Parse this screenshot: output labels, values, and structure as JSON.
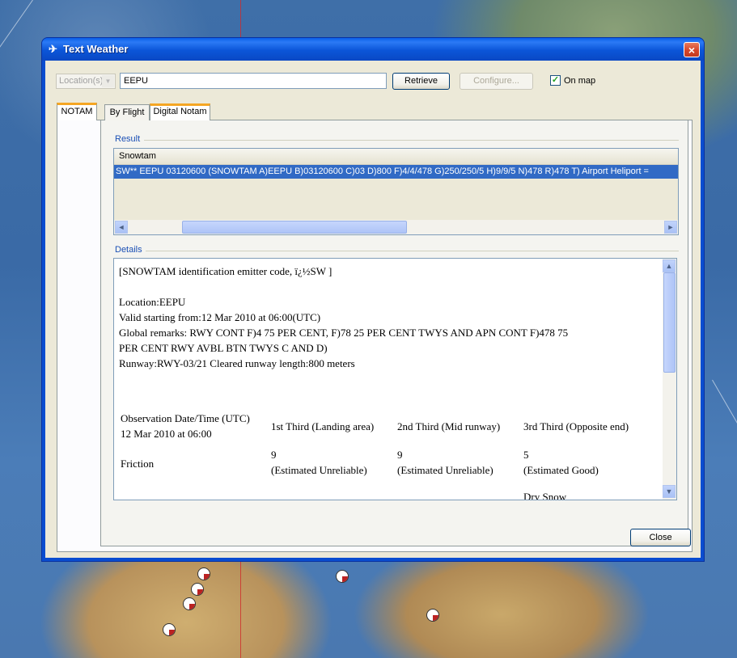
{
  "window": {
    "title": "Text Weather",
    "close_glyph": "×"
  },
  "toolbar": {
    "location_label": "Location(s)",
    "location_value": "EEPU",
    "retrieve_label": "Retrieve",
    "configure_label": "Configure...",
    "on_map_label": "On map",
    "on_map_checked": true
  },
  "tabs": {
    "left": "NOTAM",
    "sub": [
      "By Flight",
      "Digital Notam"
    ],
    "active_sub": "Digital Notam"
  },
  "result": {
    "group_label": "Result",
    "column_header": "Snowtam",
    "row": "SW** EEPU 03120600 (SNOWTAM  A)EEPU B)03120600 C)03 D)800 F)4/4/478 G)250/250/5 H)9/9/5  N)478 R)478 T) Airport Heliport ="
  },
  "details": {
    "group_label": "Details",
    "line1": "[SNOWTAM identification emitter code, ï¿½SW ]",
    "location": "Location:EEPU",
    "valid": "Valid starting from:12 Mar 2010 at 06:00(UTC)",
    "remarks1": "Global remarks: RWY CONT F)4 75 PER CENT, F)78 25 PER CENT TWYS AND APN CONT F)478 75",
    "remarks2": "PER CENT RWY AVBL BTN TWYS C AND D)",
    "runway": "Runway:RWY-03/21 Cleared runway length:800 meters",
    "obs_header": "Observation Date/Time (UTC)",
    "obs_value": "12 Mar 2010 at 06:00",
    "col1": "1st Third (Landing area)",
    "col2": "2nd Third (Mid runway)",
    "col3": "3rd Third (Opposite end)",
    "friction_label": "Friction",
    "f1_val": "9",
    "f1_desc": "(Estimated Unreliable)",
    "f2_val": "9",
    "f2_desc": "(Estimated Unreliable)",
    "f3_val": "5",
    "f3_desc": "(Estimated Good)",
    "cut_text": "Dry Snow"
  },
  "footer": {
    "close_label": "Close"
  },
  "icons": {
    "app": "plane-icon",
    "scroll_left": "◄",
    "scroll_right": "►",
    "scroll_up": "▲",
    "scroll_down": "▼",
    "combo_arrow": "▼",
    "check": "✓"
  },
  "colors": {
    "title_bar": "#0a55d8",
    "selection": "#316ac5",
    "tab_accent": "#f5a623",
    "group_label": "#1a4fb5"
  }
}
